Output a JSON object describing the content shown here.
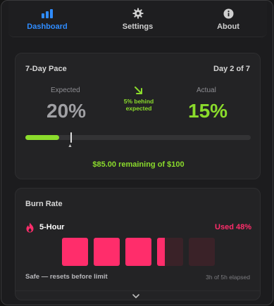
{
  "tabs": [
    {
      "label": "Dashboard",
      "icon": "bar-chart-icon",
      "active": true
    },
    {
      "label": "Settings",
      "icon": "gear-icon",
      "active": false
    },
    {
      "label": "About",
      "icon": "info-icon",
      "active": false
    }
  ],
  "pace": {
    "title": "7-Day Pace",
    "day_label": "Day 2 of 7",
    "expected_label": "Expected",
    "expected_value": "20%",
    "actual_label": "Actual",
    "actual_value": "15%",
    "delta_line1": "5% behind",
    "delta_line2": "expected",
    "progress_fraction": 0.15,
    "expected_fraction": 0.2,
    "remaining_text": "$85.00 remaining of $100"
  },
  "burn": {
    "title": "Burn Rate",
    "window_name": "5-Hour",
    "used_text": "Used 48%",
    "blocks_total": 5,
    "blocks_filled": 3.3,
    "status_text": "Safe — resets before limit",
    "elapsed_text": "3h of 5h elapsed"
  },
  "colors": {
    "accent_blue": "#2f8cff",
    "accent_green": "#8bdc2c",
    "accent_pink": "#ff2d6b",
    "background": "#1c1c1e",
    "card": "#232325"
  },
  "icons": {
    "flame": "flame-icon",
    "arrow": "arrow-down-right-icon",
    "more": "chevron-down-icon"
  }
}
